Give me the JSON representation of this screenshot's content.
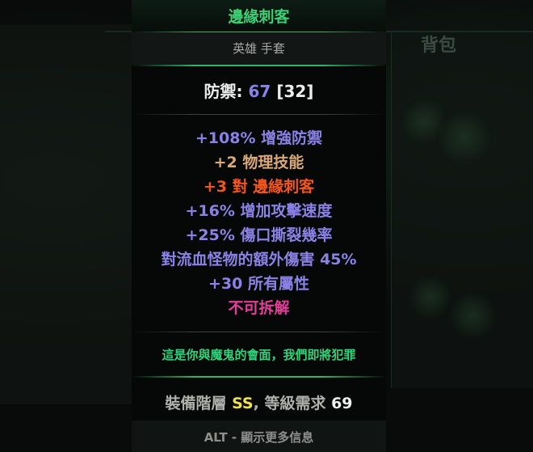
{
  "background": {
    "panel_title": "背包"
  },
  "tooltip": {
    "item_name": "邊緣刺客",
    "item_type": "英雄 手套",
    "defense": {
      "label": "防禦:",
      "value": "67",
      "base": "[32]"
    },
    "affixes": [
      {
        "text": "+108% 增強防禦",
        "color": "#8a82e6"
      },
      {
        "text": "+2 物理技能",
        "color": "#d9a877"
      },
      {
        "text": "+3 對  邊緣刺客",
        "color": "#f2561d"
      },
      {
        "text": "+16% 增加攻擊速度",
        "color": "#8a82e6"
      },
      {
        "text": "+25% 傷口撕裂幾率",
        "color": "#8a82e6"
      },
      {
        "text": "對流血怪物的額外傷害 45%",
        "color": "#8a82e6"
      },
      {
        "text": "+30 所有屬性",
        "color": "#8a82e6"
      },
      {
        "text": "不可拆解",
        "color": "#e43d9a"
      }
    ],
    "flavor_text": "這是你與魔鬼的會面，我們即將犯罪",
    "requirement": {
      "prefix": "裝備階層 ",
      "tier": "SS",
      "middle": ", 等級需求 ",
      "level": "69"
    },
    "alt_hint": "ALT - 顯示更多信息"
  },
  "colors": {
    "name_green": "#3ccf74",
    "affix_blue": "#8a82e6",
    "affix_tan": "#d9a877",
    "affix_orange": "#f2561d",
    "affix_pink": "#e43d9a",
    "tier_yellow": "#f2e24a"
  }
}
